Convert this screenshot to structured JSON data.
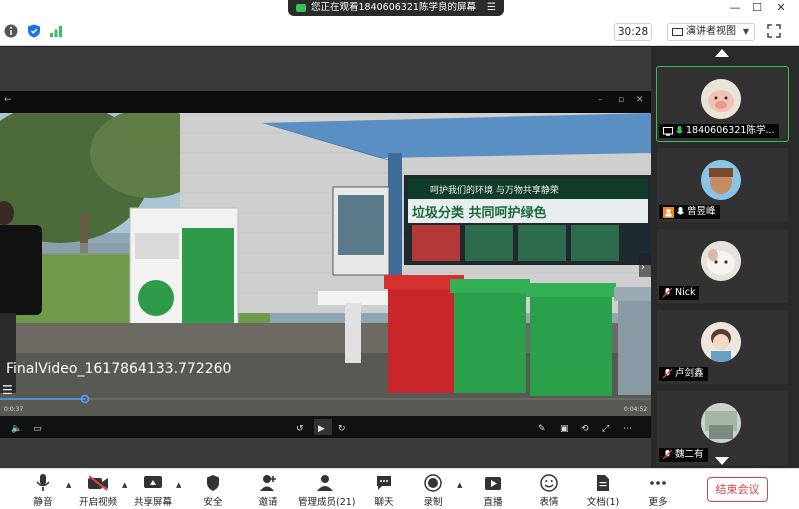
{
  "window": {
    "share_banner": "您正在观看1840606321陈学良的屏幕",
    "timer": "30:28",
    "view_mode": "演讲者视图"
  },
  "shared_video": {
    "overlay_text": "FinalVideo_1617864133.772260",
    "time_current": "0:0:37",
    "time_total": "0:04:52",
    "progress": 0.13,
    "banner_text": "呵护我们的环境 与万物共享静荣",
    "slogan_text": "垃圾分类 共同呵护绿色"
  },
  "participants": [
    {
      "name": "1840606321陈学...",
      "active": true,
      "mic": "on",
      "sharing": true
    },
    {
      "name": "曾昱峰",
      "active": false,
      "mic": "on",
      "host_badge": true
    },
    {
      "name": "Nick",
      "active": false,
      "mic": "muted"
    },
    {
      "name": "卢剑鑫",
      "active": false,
      "mic": "muted"
    },
    {
      "name": "魏二有",
      "active": false,
      "mic": "muted"
    }
  ],
  "bottom_bar": {
    "mute": "静音",
    "video": "开启视频",
    "share": "共享屏幕",
    "security": "安全",
    "invite": "邀请",
    "members": "管理成员(21)",
    "chat": "聊天",
    "record": "录制",
    "live": "直播",
    "reaction": "表情",
    "docs": "文档(1)",
    "more": "更多",
    "end": "结束会议"
  },
  "colors": {
    "accent_green": "#35c15a",
    "end_red": "#e24444",
    "stage_bg": "#3a3a3a"
  }
}
